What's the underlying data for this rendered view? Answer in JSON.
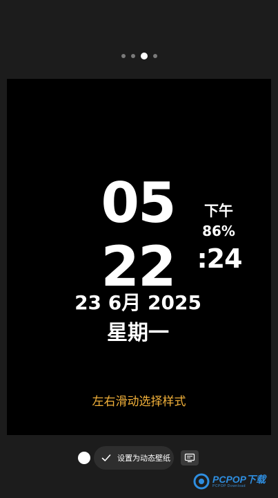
{
  "pager": {
    "count": 4,
    "active_index": 2
  },
  "clock": {
    "hour": "05",
    "minute": "22",
    "ampm": "下午",
    "battery": "86%",
    "seconds": ":24",
    "date": "23 6月 2025",
    "weekday": "星期一"
  },
  "hint": "左右滑动选择样式",
  "actions": {
    "set_wallpaper_label": "设置为动态壁纸",
    "swatch_color": "#ffffff"
  },
  "watermark": {
    "brand": "PCPOP下载",
    "sub": "PCPOP Download"
  },
  "colors": {
    "accent": "#f2b13a",
    "watermark": "#2e8ee0"
  }
}
